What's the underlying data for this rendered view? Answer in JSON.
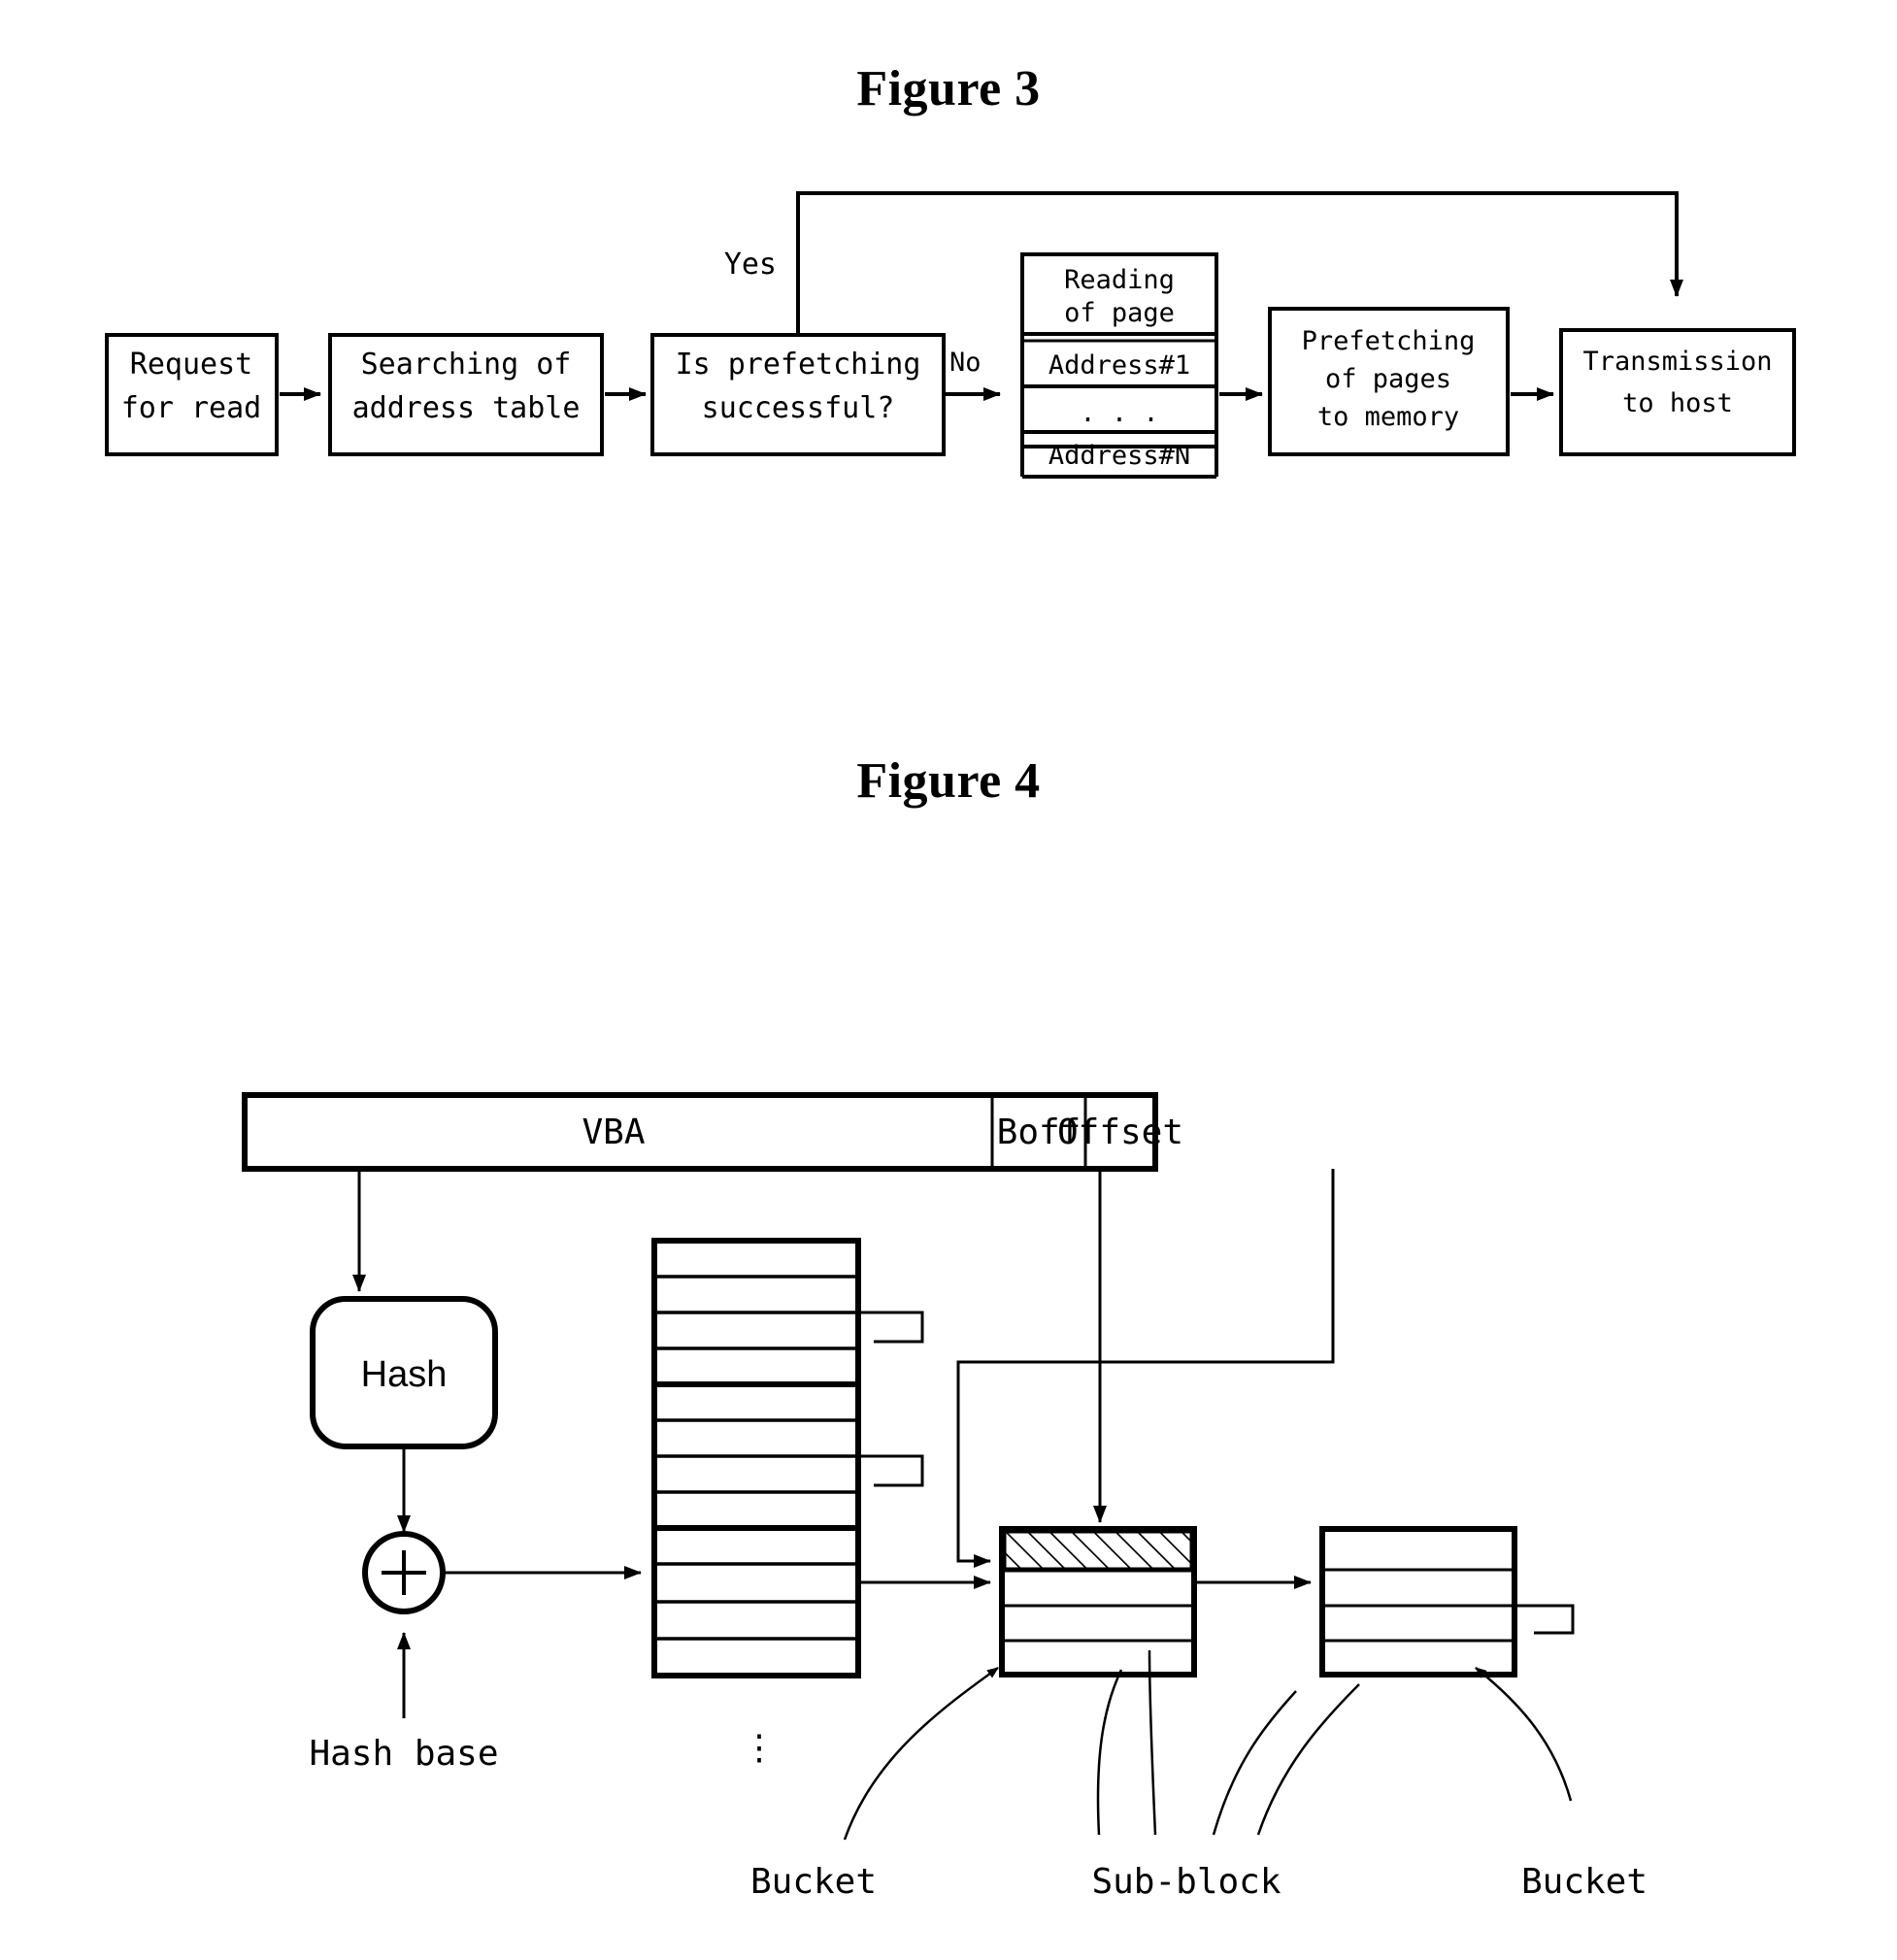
{
  "figures": [
    {
      "id": "figure-3",
      "title": "Figure 3",
      "type": "flowchart",
      "nodes": [
        {
          "id": "request-for-read",
          "lines": [
            "Request",
            "for read"
          ]
        },
        {
          "id": "searching-of-address-table",
          "lines": [
            "Searching of",
            "address table"
          ]
        },
        {
          "id": "is-prefetching-successful",
          "lines": [
            "Is prefetching",
            "successful?"
          ]
        },
        {
          "id": "address-table-stack",
          "header": [
            "Reading",
            "of page"
          ],
          "rows": [
            "Address#1",
            ". . .",
            "Address#N"
          ]
        },
        {
          "id": "prefetching-of-pages-to-memory",
          "lines": [
            "Prefetching",
            "of pages",
            "to memory"
          ]
        },
        {
          "id": "transmission-to-host",
          "lines": [
            "Transmission",
            "to host"
          ]
        }
      ],
      "edge_labels": {
        "yes": "Yes",
        "no": "No"
      }
    },
    {
      "id": "figure-4",
      "title": "Figure 4",
      "type": "block-diagram",
      "address_fields": [
        {
          "id": "vba",
          "label": "VBA"
        },
        {
          "id": "boff",
          "label": "Boff"
        },
        {
          "id": "offset",
          "label": "Offset"
        }
      ],
      "hash_block": {
        "label": "Hash"
      },
      "adder": {
        "symbol": "+"
      },
      "hash_base": {
        "label": "Hash base"
      },
      "hash_table": {
        "row_count": 12,
        "bold_after_rows": [
          4,
          8
        ],
        "ellipsis": "⋮"
      },
      "buckets": [
        {
          "id": "bucket-left",
          "rows": 4,
          "hatched_row_index": 0
        },
        {
          "id": "bucket-right",
          "rows": 4,
          "hatched_row_index": -1
        }
      ],
      "callouts": [
        {
          "id": "callout-bucket-left",
          "label": "Bucket"
        },
        {
          "id": "callout-sub-block",
          "label": "Sub-block"
        },
        {
          "id": "callout-bucket-right",
          "label": "Bucket"
        }
      ]
    }
  ],
  "colors": {
    "ink": "#000000",
    "paper": "#ffffff"
  }
}
